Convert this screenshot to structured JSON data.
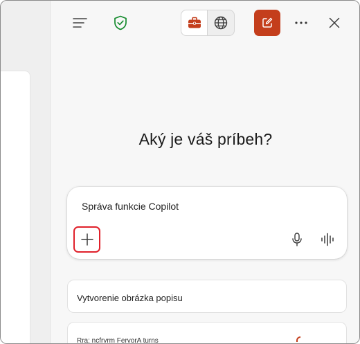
{
  "toolbar": {
    "menu_icon": "hamburger-menu-icon",
    "shield_icon": "shield-check-icon",
    "work_icon": "briefcase-icon",
    "web_icon": "globe-icon",
    "new_chat_icon": "compose-icon",
    "more_icon": "ellipsis-icon",
    "close_icon": "close-icon"
  },
  "colors": {
    "accent": "#c43e1c",
    "shield": "#138a2c",
    "highlight": "#e0202a"
  },
  "main": {
    "heading": "Aký je váš príbeh?"
  },
  "composer": {
    "text": "Správa funkcie Copilot",
    "add_icon": "plus-icon",
    "mic_icon": "microphone-icon",
    "voice_icon": "voice-waveform-icon"
  },
  "suggestions": [
    {
      "label": "Vytvorenie obrázka popisu"
    },
    {
      "label": "Rra: ncfrvrm FervorA turns"
    }
  ]
}
